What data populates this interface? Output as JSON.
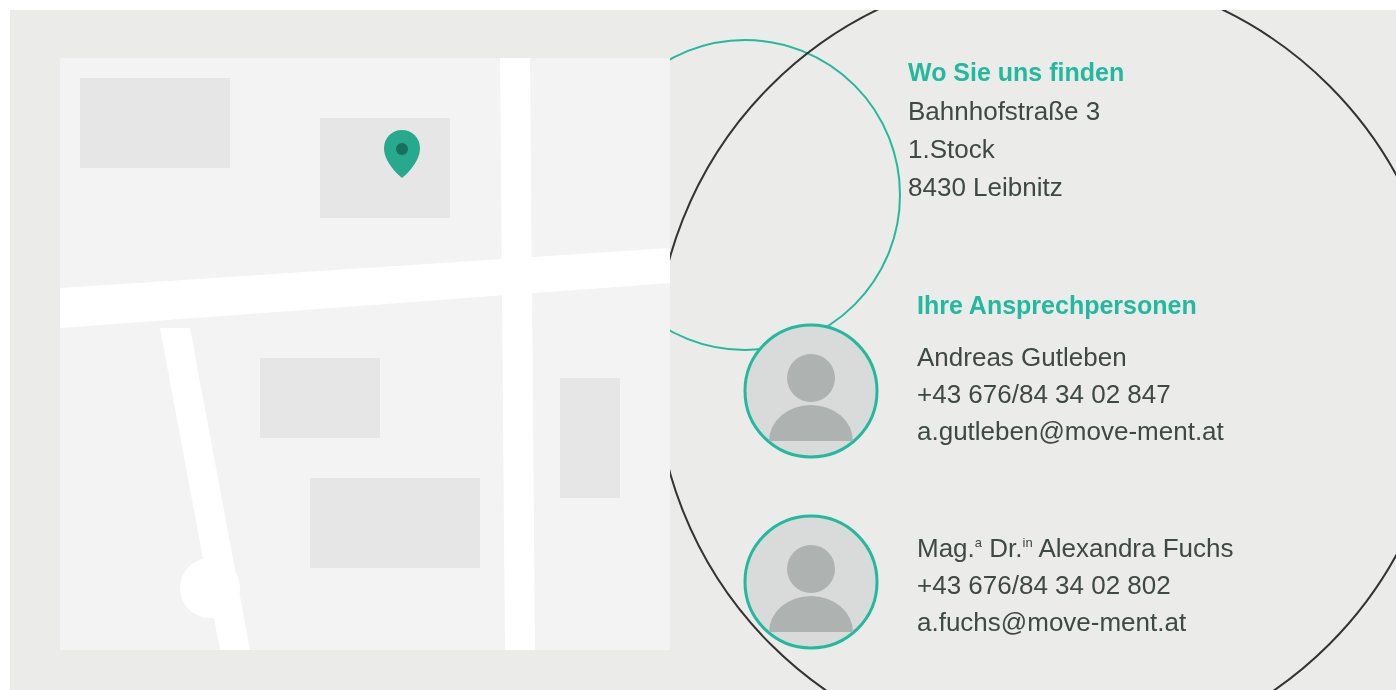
{
  "location": {
    "heading": "Wo Sie uns finden",
    "lines": [
      "Bahnhofstraße 3",
      "1.Stock",
      "8430 Leibnitz"
    ]
  },
  "contacts": {
    "heading": "Ihre Ansprechpersonen",
    "people": [
      {
        "name": "Andreas Gutleben",
        "phone": "+43 676/84 34 02 847",
        "email": "a.gutleben@move-ment.at"
      },
      {
        "name": "Mag.$^{a}$ Dr.$^{in}$ Alexandra Fuchs",
        "phone": "+43 676/84 34 02 802",
        "email": "a.fuchs@move-ment.at"
      }
    ]
  }
}
